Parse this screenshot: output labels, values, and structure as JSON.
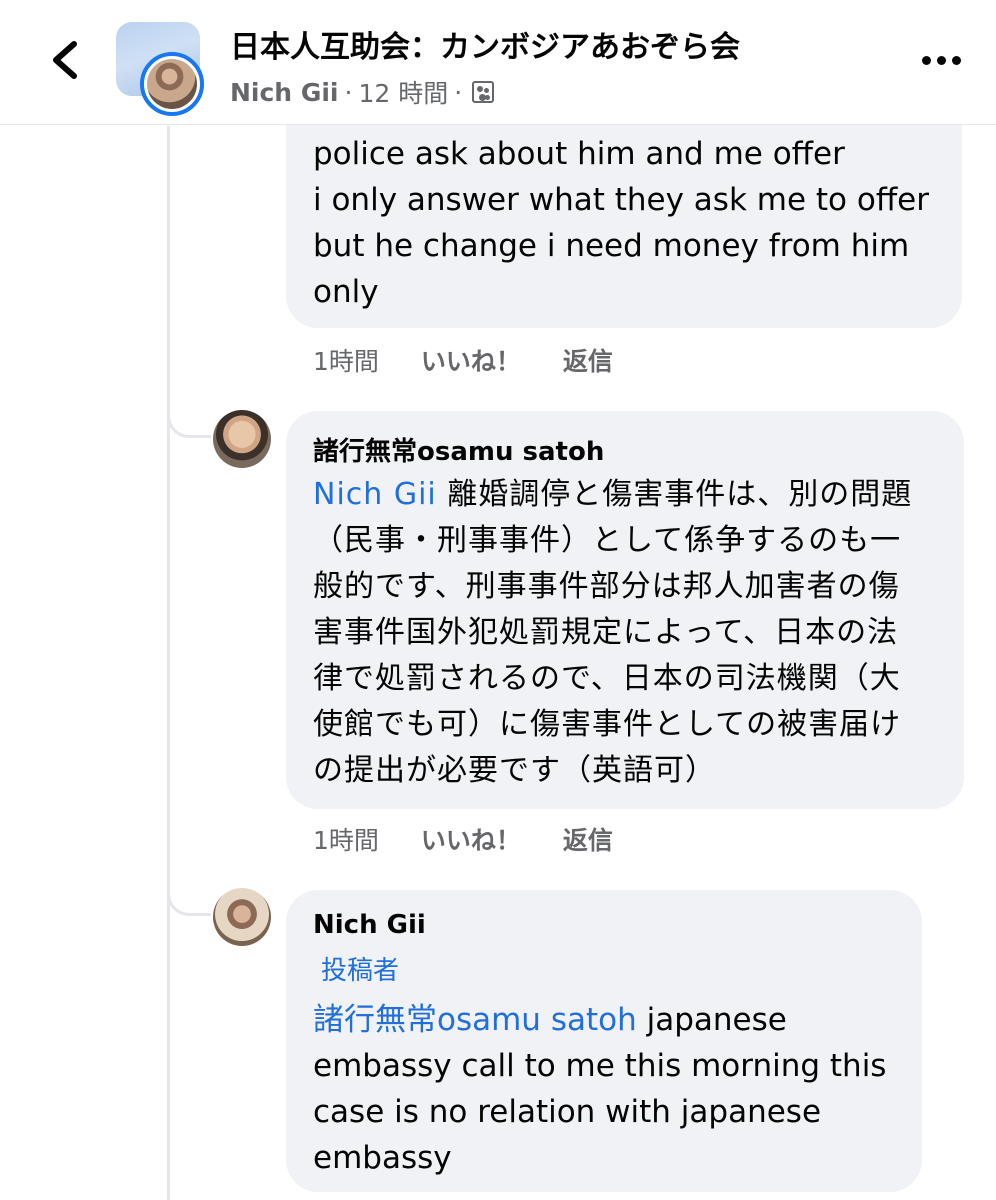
{
  "header": {
    "group_name": "日本人互助会：カンボジアあおぞら会",
    "post_author": "Nich Gii",
    "separator1": "·",
    "post_time": "12 時間",
    "separator2": "·",
    "audience_icon": "group-audience-icon",
    "back_icon": "chevron-left-icon",
    "more_icon": "more-horizontal-icon"
  },
  "comments": [
    {
      "author": "",
      "lines": [
        "police ask about him and me offer",
        "i only answer what they ask me to offer",
        "but he change i need money from him",
        "only"
      ],
      "time": "1時間",
      "like_label": "いいね！",
      "reply_label": "返信"
    },
    {
      "author": "諸行無常osamu satoh",
      "mention": "Nich Gii",
      "lines": [
        "離婚調停と傷害事件は、別の問題",
        "（民事・刑事事件）として係争するのも一",
        "般的です、刑事事件部分は邦人加害者の傷",
        "害事件国外犯処罰規定によって、日本の法",
        "律で処罰されるので、日本の司法機関（大",
        "使館でも可）に傷害事件としての被害届け",
        "の提出が必要です（英語可）"
      ],
      "time": "1時間",
      "like_label": "いいね！",
      "reply_label": "返信"
    },
    {
      "author": "Nich Gii",
      "badge": "投稿者",
      "mention": "諸行無常osamu satoh",
      "lines": [
        "japanese",
        "embassy call to me this morning this",
        "case is no relation with japanese",
        "embassy"
      ]
    }
  ]
}
